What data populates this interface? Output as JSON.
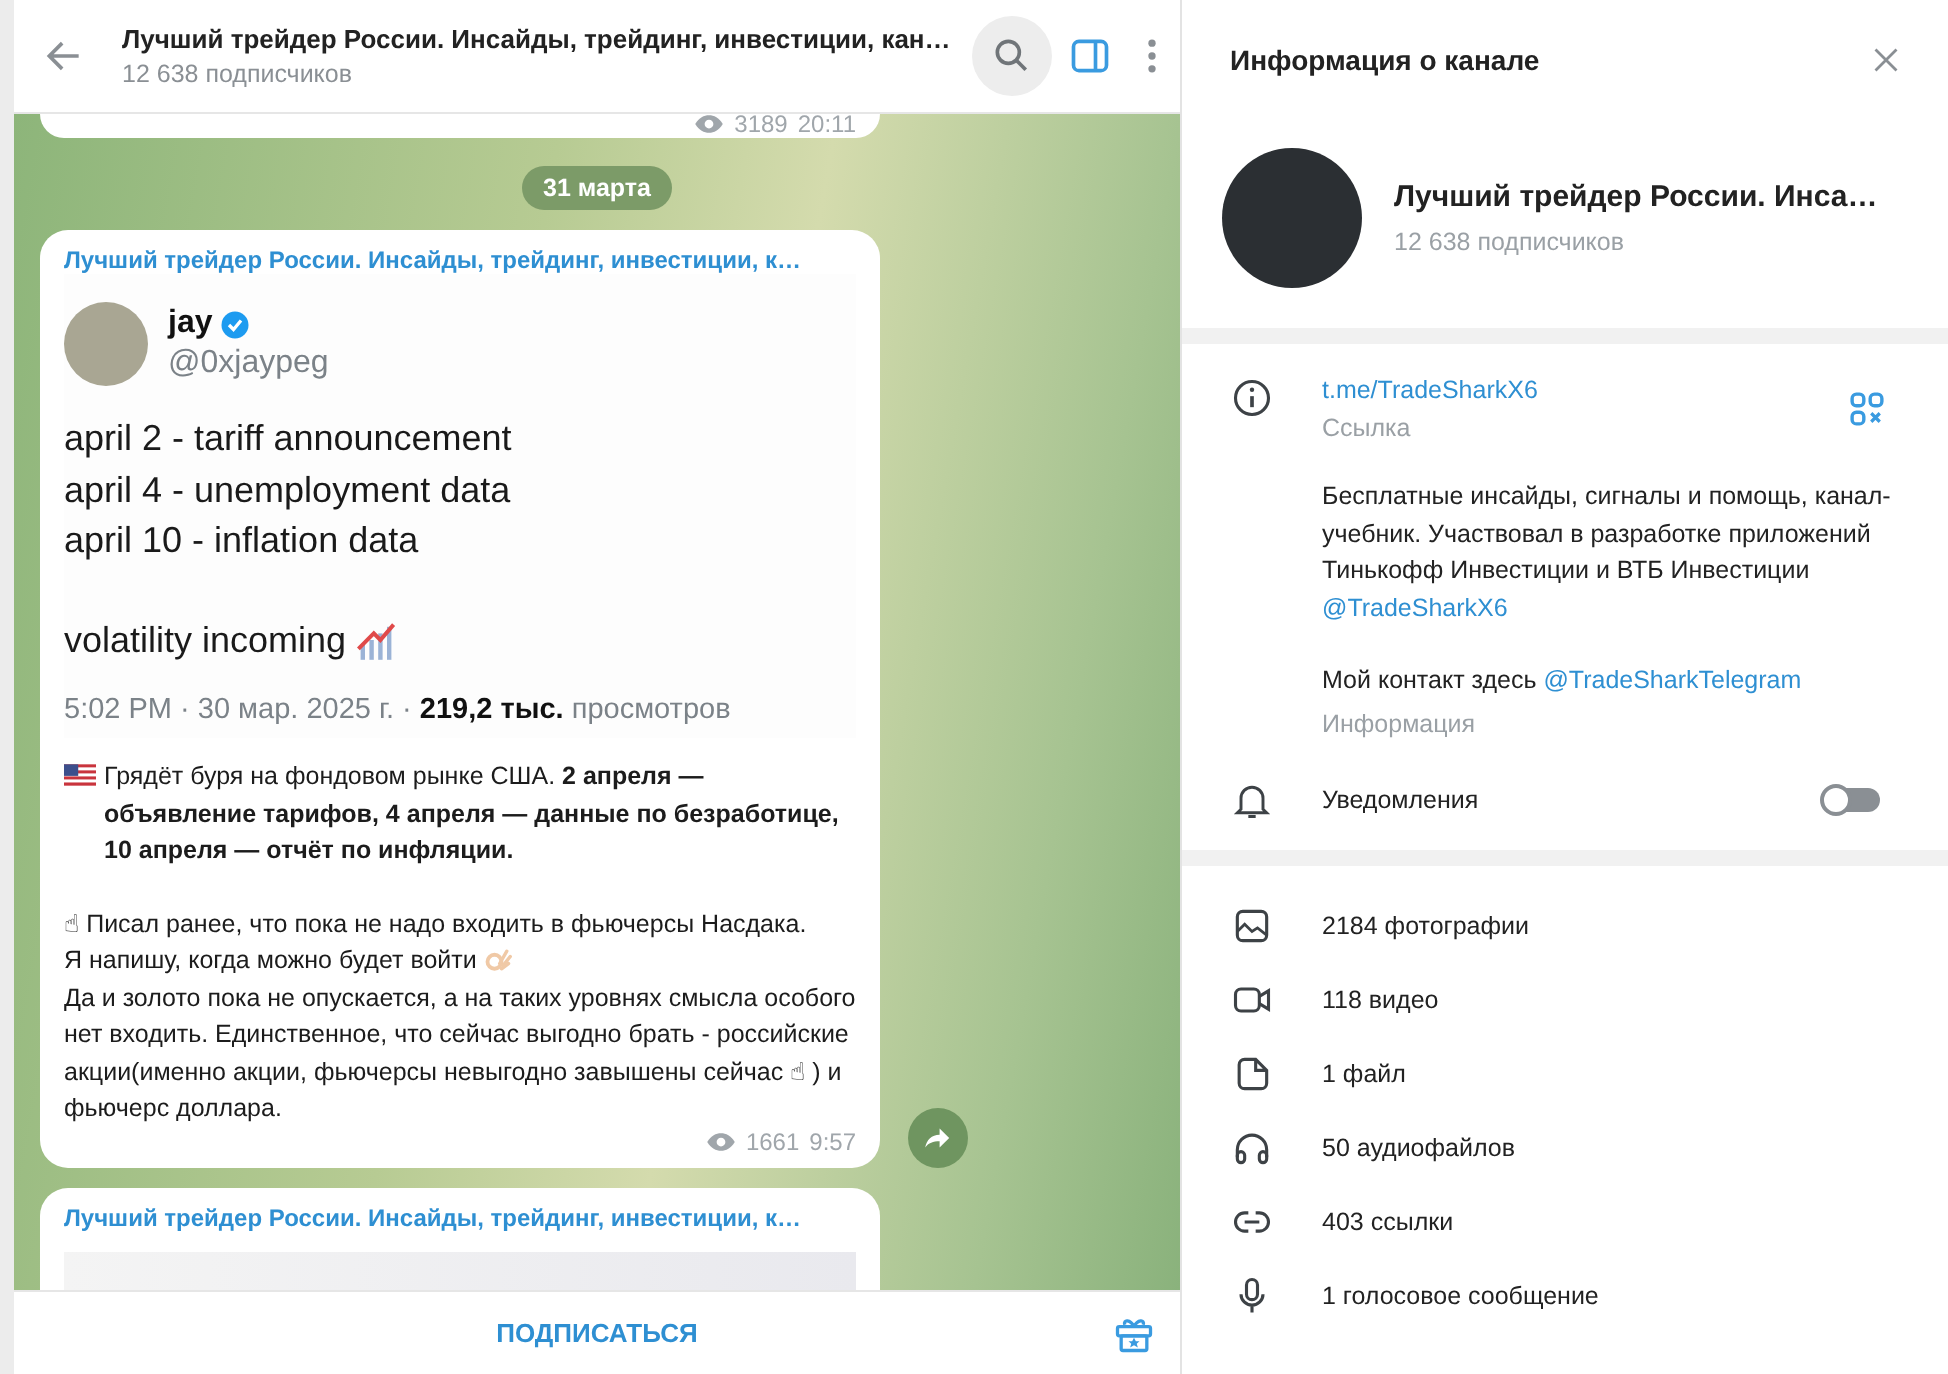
{
  "chat_header": {
    "title": "Лучший трейдер России. Инсайды, трейдинг, инвестиции, кан…",
    "subtitle": "12 638 подписчиков"
  },
  "messages": [
    {
      "kind": "tail",
      "views": "3189",
      "time": "20:11"
    },
    {
      "kind": "date",
      "text": "31 марта"
    },
    {
      "kind": "post",
      "channel": "Лучший трейдер России. Инсайды, трейдинг, инвестиции, к…",
      "tweet": {
        "name": "jay",
        "handle": "@0xjaypeg",
        "lines": [
          "april 2 - tariff announcement",
          "april 4 - unemployment data",
          "april 10 - inflation data"
        ],
        "closing": "volatility incoming",
        "footer": "5:02 PM · 30 мар. 2025 г. · **219,2 тыс.** просмотров"
      },
      "blocks": [
        {
          "kind": "flag",
          "text": "Грядёт буря на фондовом рынке США. **2 апреля — объявление тарифов, 4 апреля — данные по безработице, 10 апреля — отчёт по инфляции.**"
        },
        {
          "kind": "plain",
          "text": "☝ Писал ранее, что пока не надо входить в фьючерсы Насдака."
        },
        {
          "kind": "ok",
          "text": "Я напишу, когда можно будет войти"
        },
        {
          "kind": "plain",
          "text": "Да и золото пока не опускается, а на таких уровнях смысла особого нет входить. Единственное, что сейчас выгодно брать - российские акции(именно акции, фьючерсы невыгодно завышены сейчас ☝ ) и фьючерс доллара."
        }
      ],
      "views": "1661",
      "time": "9:57"
    },
    {
      "kind": "preview",
      "channel": "Лучший трейдер России. Инсайды, трейдинг, инвестиции, к…"
    }
  ],
  "subscribe_button": "ПОДПИСАТЬСЯ",
  "info_panel": {
    "title": "Информация о канале",
    "channel_name": "Лучший трейдер России. Инса…",
    "subscribers": "12 638 подписчиков",
    "link": "t.me/TradeSharkX6",
    "link_label": "Ссылка",
    "description": [
      {
        "text": "Бесплатные инсайды, сигналы и помощь, канал-учебник. Участвовал в разработке приложений Тинькофф Инвестиции и ВТБ Инвестиции ",
        "mention": "@TradeSharkX6"
      },
      {
        "text": "Мой контакт здесь ",
        "mention": "@TradeSharkTelegram"
      }
    ],
    "description_label": "Информация",
    "notifications": {
      "label": "Уведомления",
      "on": false
    },
    "media": [
      {
        "kind": "photo",
        "text": "2184 фотографии"
      },
      {
        "kind": "video",
        "text": "118 видео"
      },
      {
        "kind": "file",
        "text": "1 файл"
      },
      {
        "kind": "audio",
        "text": "50 аудиофайлов"
      },
      {
        "kind": "link",
        "text": "403 ссылки"
      },
      {
        "kind": "voice",
        "text": "1 голосовое сообщение"
      }
    ]
  }
}
